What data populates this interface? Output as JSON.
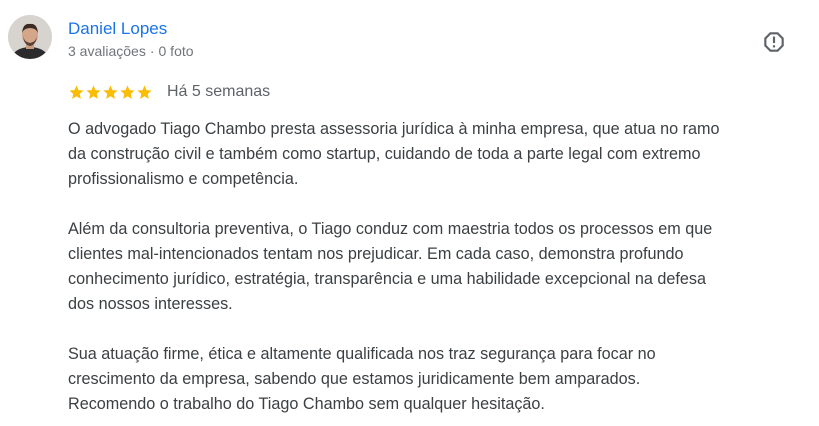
{
  "review": {
    "author": {
      "name": "Daniel Lopes",
      "reviews_count": "3 avaliações",
      "separator": "·",
      "photos_count": "0 foto"
    },
    "rating": {
      "stars": 5,
      "max_stars": 5,
      "star_color": "#fbbc04"
    },
    "date": "Há 5 semanas",
    "paragraphs": [
      {
        "lines": [
          "O advogado Tiago Chambo presta assessoria jurídica à minha empresa, que atua no ramo",
          "da construção civil e também como startup, cuidando de toda a parte legal com extremo",
          "profissionalismo e competência."
        ]
      },
      {
        "lines": [
          "Além da consultoria preventiva, o Tiago conduz com maestria todos os processos em que",
          "clientes mal-intencionados tentam nos prejudicar. Em cada caso, demonstra profundo",
          "conhecimento jurídico, estratégia, transparência e uma habilidade excepcional na defesa",
          "dos nossos interesses."
        ]
      },
      {
        "lines": [
          "Sua atuação firme, ética e altamente qualificada nos traz segurança para focar no",
          "crescimento da empresa, sabendo que estamos juridicamente bem amparados.",
          "Recomendo o trabalho do Tiago Chambo sem qualquer hesitação."
        ]
      }
    ]
  },
  "icons": {
    "avatar": "user-photo",
    "report": "report-alert-icon",
    "star": "star-icon"
  },
  "colors": {
    "author_link": "#1a73e8",
    "meta_text": "#70757a",
    "body_text": "#3c4043",
    "icon": "#5f6368"
  }
}
